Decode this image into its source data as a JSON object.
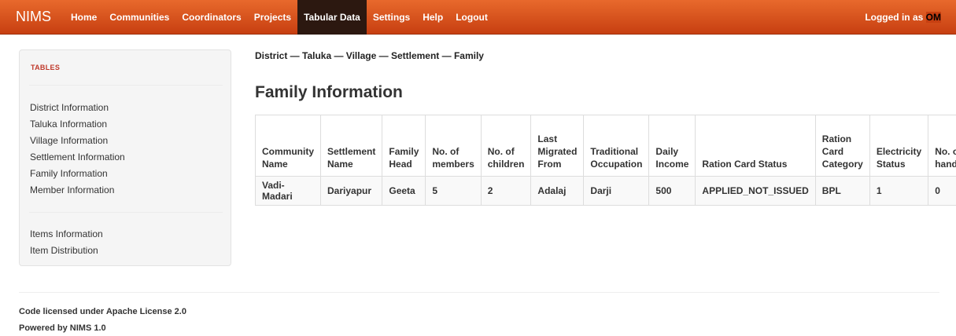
{
  "navbar": {
    "brand": "NIMS",
    "links": [
      "Home",
      "Communities",
      "Coordinators",
      "Projects",
      "Tabular Data",
      "Settings",
      "Help",
      "Logout"
    ],
    "active_link": "Tabular Data",
    "logged_in_prefix": "Logged in as ",
    "logged_in_user": "OM"
  },
  "sidebar": {
    "header": "TABLES",
    "group1": [
      "District Information",
      "Taluka Information",
      "Village Information",
      "Settlement Information",
      "Family Information",
      "Member Information"
    ],
    "group2": [
      "Items Information",
      "Item Distribution"
    ]
  },
  "main": {
    "breadcrumb": "District — Taluka — Village — Settlement — Family",
    "title": "Family Information",
    "table": {
      "headers": [
        "Community Name",
        "Settlement Name",
        "Family Head",
        "No. of members",
        "No. of children",
        "Last Migrated From",
        "Traditional Occupation",
        "Daily Income",
        "Ration Card Status",
        "Ration Card Category",
        "Electricity Status",
        "No. of handicappe"
      ],
      "rows": [
        [
          "Vadi-Madari",
          "Dariyapur",
          "Geeta",
          "5",
          "2",
          "Adalaj",
          "Darji",
          "500",
          "APPLIED_NOT_ISSUED",
          "BPL",
          "1",
          "0"
        ]
      ]
    }
  },
  "footer": {
    "license_prefix": "Code licensed under ",
    "license": "Apache License 2.0",
    "powered_prefix": "Powered by ",
    "powered": "NIMS 1.0"
  },
  "colors": {
    "navbar_top": "#e8692c",
    "navbar_bottom": "#c73f11",
    "active_tab": "#2c1810",
    "sidebar_header": "#c0392b"
  }
}
